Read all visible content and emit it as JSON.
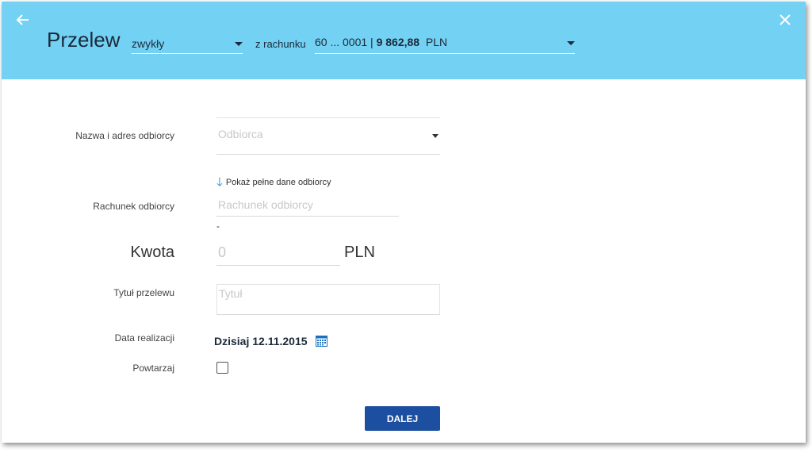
{
  "header": {
    "title": "Przelew",
    "type_value": "zwykły",
    "from_label": "z rachunku",
    "account_number": "60 ... 0001 | ",
    "account_balance": "9 862,88",
    "account_currency": "PLN"
  },
  "form": {
    "recipient": {
      "label": "Nazwa i adres odbiorcy",
      "placeholder": "Odbiorca"
    },
    "show_full": "Pokaż pełne dane odbiorcy",
    "account": {
      "label": "Rachunek odbiorcy",
      "placeholder": "Rachunek odbiorcy",
      "below": "-"
    },
    "amount": {
      "label": "Kwota",
      "placeholder": "0",
      "currency": "PLN"
    },
    "transfer_title": {
      "label": "Tytuł przelewu",
      "placeholder": "Tytuł"
    },
    "date": {
      "label": "Data realizacji",
      "value": "Dzisiaj 12.11.2015"
    },
    "repeat": {
      "label": "Powtarzaj",
      "checked": false
    }
  },
  "actions": {
    "next_label": "DALEJ"
  },
  "icons": {
    "back": "arrow-left-icon",
    "close": "close-icon",
    "calendar": "calendar-icon",
    "show_full": "arrow-down-icon"
  },
  "colors": {
    "header_bg": "#73d1f3",
    "primary_button": "#1c4fa0",
    "link_arrow": "#1a8ad1"
  }
}
